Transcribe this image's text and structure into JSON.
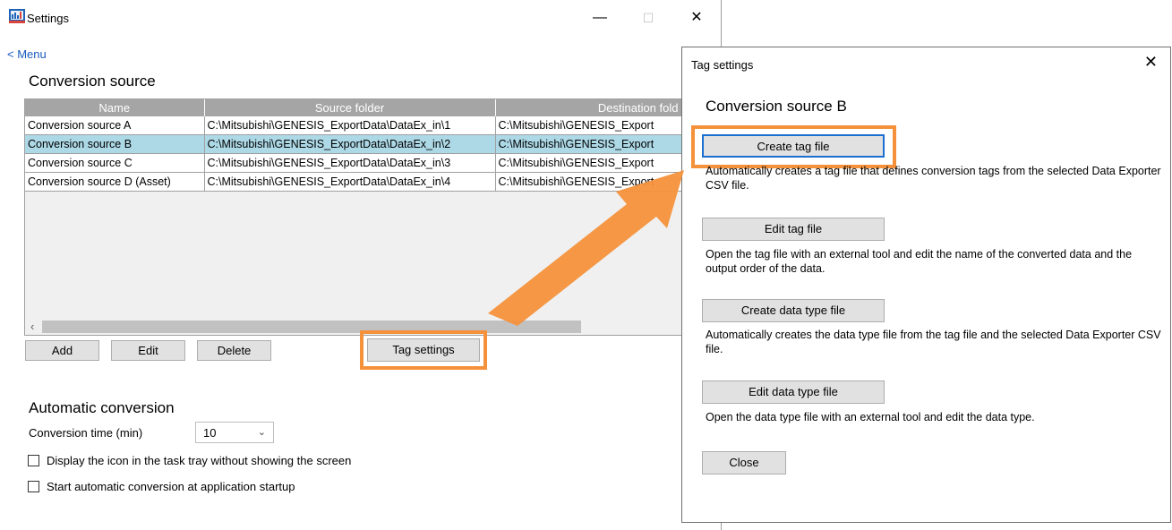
{
  "window": {
    "title": "Settings",
    "min_glyph": "—",
    "max_glyph": "☐",
    "close_glyph": "✕"
  },
  "menu_link": "< Menu",
  "conversion_source": {
    "title": "Conversion source",
    "columns": [
      "Name",
      "Source folder",
      "Destination fold"
    ],
    "rows": [
      {
        "name": "Conversion source A",
        "source": "C:\\Mitsubishi\\GENESIS_ExportData\\DataEx_in\\1",
        "dest": "C:\\Mitsubishi\\GENESIS_Export"
      },
      {
        "name": "Conversion source B",
        "source": "C:\\Mitsubishi\\GENESIS_ExportData\\DataEx_in\\2",
        "dest": "C:\\Mitsubishi\\GENESIS_Export",
        "selected": true
      },
      {
        "name": "Conversion source C",
        "source": "C:\\Mitsubishi\\GENESIS_ExportData\\DataEx_in\\3",
        "dest": "C:\\Mitsubishi\\GENESIS_Export"
      },
      {
        "name": "Conversion source D (Asset)",
        "source": "C:\\Mitsubishi\\GENESIS_ExportData\\DataEx_in\\4",
        "dest": "C:\\Mitsubishi\\GENESIS_Export"
      }
    ],
    "scroll_left_glyph": "‹",
    "buttons": {
      "add": "Add",
      "edit": "Edit",
      "delete": "Delete",
      "tag_settings": "Tag settings"
    }
  },
  "automatic_conversion": {
    "title": "Automatic conversion",
    "time_label": "Conversion time (min)",
    "time_value": "10",
    "chevron_glyph": "⌄",
    "option_tray": {
      "label": "Display the icon in the task tray without showing the screen",
      "checked": false
    },
    "option_startup": {
      "label": "Start automatic conversion at application startup",
      "checked": false
    }
  },
  "tag_dialog": {
    "title": "Tag settings",
    "close_glyph": "✕",
    "heading": "Conversion source B",
    "create_tag_button": "Create tag file",
    "create_tag_desc": "Automatically creates a tag file that defines conversion tags from the selected Data Exporter CSV file.",
    "edit_tag_button": "Edit tag file",
    "edit_tag_desc": "Open the tag file with an external tool and edit the name of the converted data and the output order of the data.",
    "create_type_button": "Create data type file",
    "create_type_desc": "Automatically creates the data type file from the tag file and the selected Data Exporter CSV file.",
    "edit_type_button": "Edit data type file",
    "edit_type_desc": "Open the data type file with an external tool and edit the data type.",
    "close_button": "Close"
  },
  "colors": {
    "highlight": "#f4913a",
    "selected_row": "#add8e6",
    "link": "#1a5bbd",
    "header": "#a5a5a5"
  },
  "icons": [
    "app-icon",
    "minimize-icon",
    "maximize-icon",
    "close-icon",
    "chevron-down-icon",
    "arrow-annotation"
  ]
}
